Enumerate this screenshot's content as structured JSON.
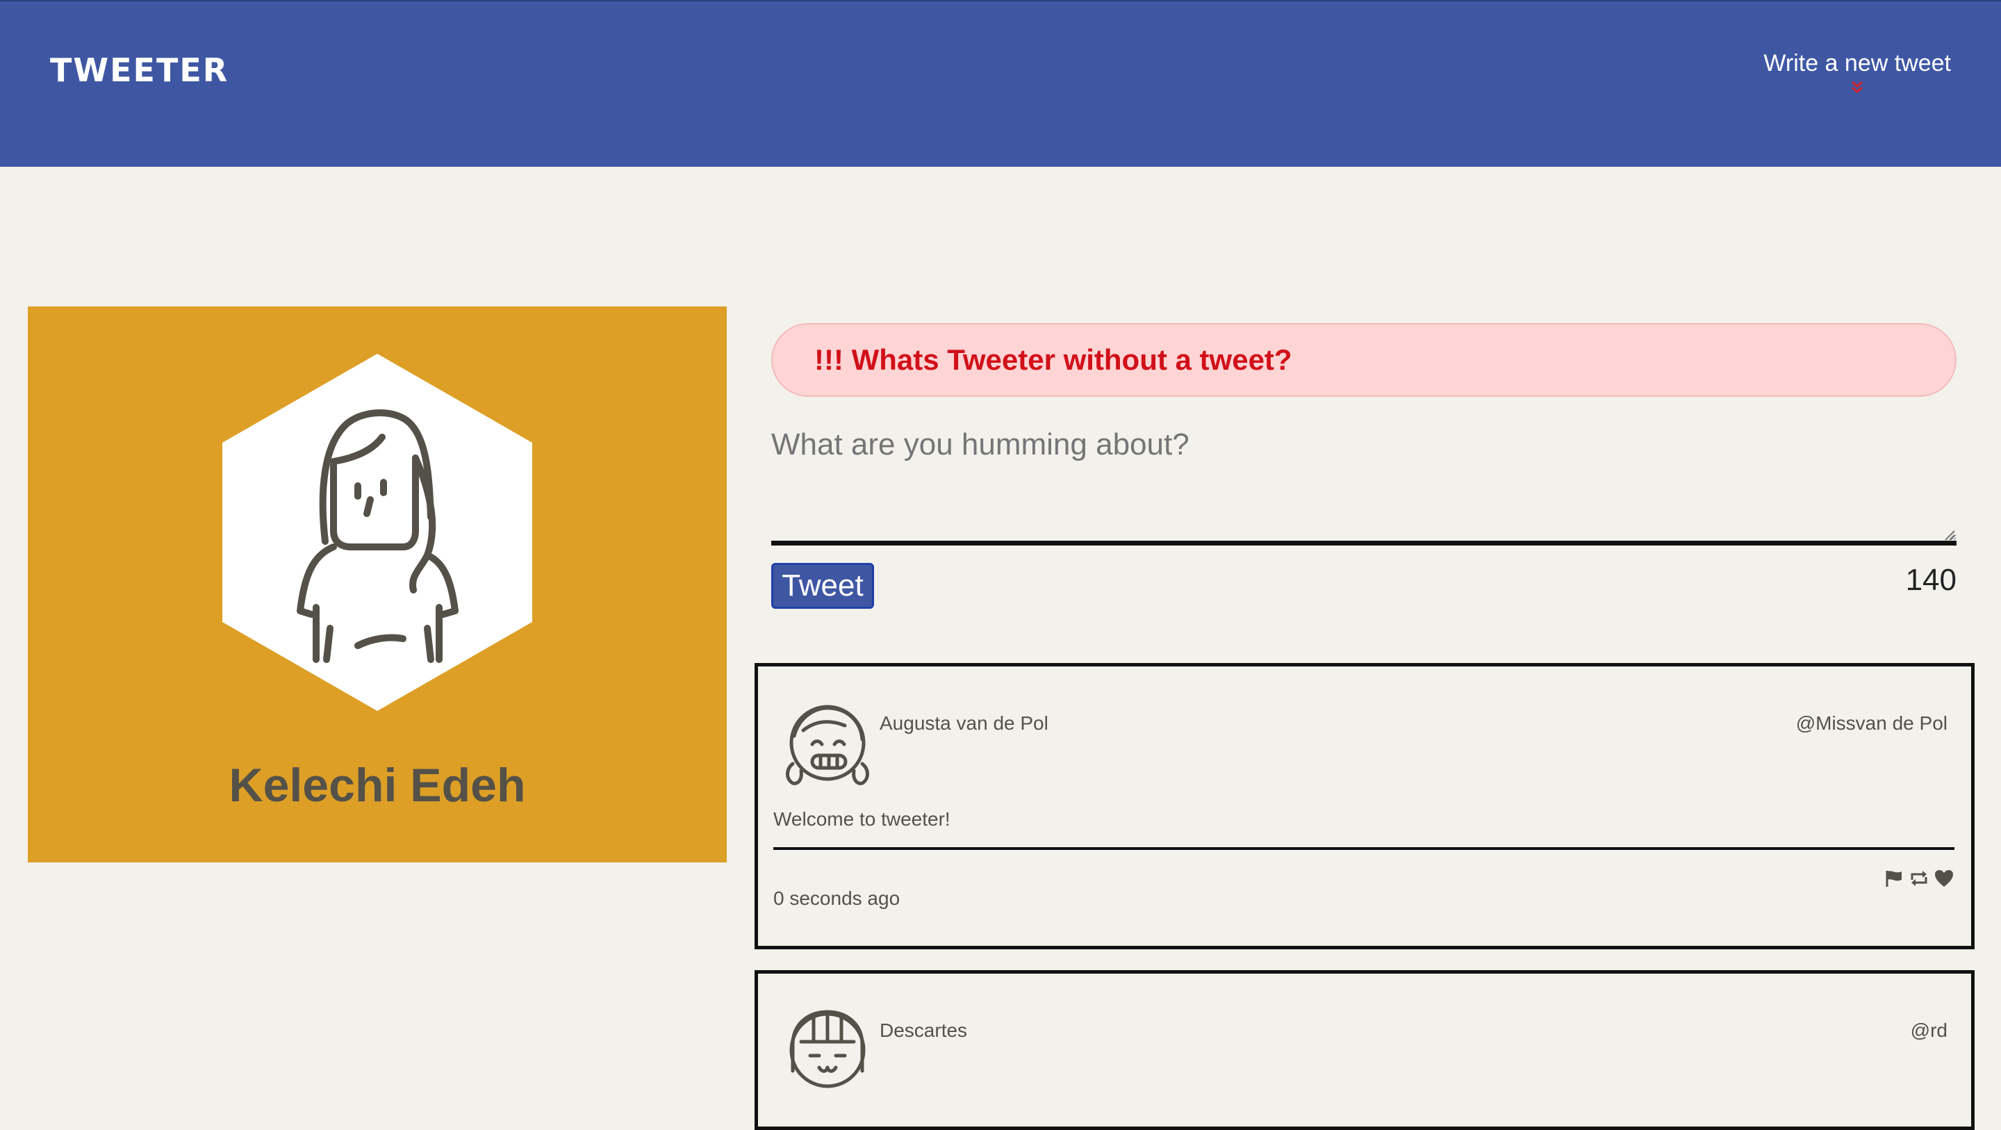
{
  "nav": {
    "brand": "TWEETER",
    "compose_toggle_label": "Write a new tweet",
    "compose_toggle_icon": "double-chevron-down-icon",
    "accent_color": "#d4222a",
    "background_color": "#3f57a3"
  },
  "profile": {
    "name": "Kelechi Edeh",
    "avatar_icon": "woman-avatar-icon",
    "background_color": "#dd9f26"
  },
  "compose": {
    "error_message": "!!! Whats Tweeter without a tweet?",
    "placeholder": "What are you humming about?",
    "submit_label": "Tweet",
    "char_count": "140"
  },
  "tweets": [
    {
      "author": "Augusta van de Pol",
      "handle": "@Missvan de Pol",
      "text": "Welcome to tweeter!",
      "time": "0 seconds ago",
      "avatar_icon": "smiling-girl-avatar-icon",
      "actions": [
        "flag-icon",
        "retweet-icon",
        "heart-icon"
      ]
    },
    {
      "author": "Descartes",
      "handle": "@rd",
      "avatar_icon": "bob-haircut-avatar-icon"
    }
  ]
}
